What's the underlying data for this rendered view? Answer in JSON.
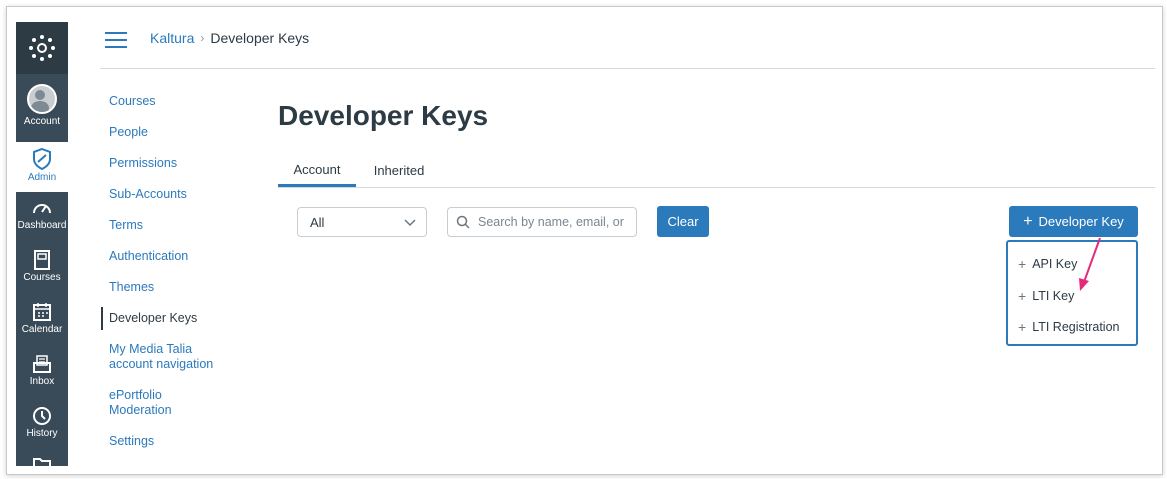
{
  "global_nav": {
    "items": [
      {
        "label": "Account",
        "icon": "user-avatar-icon"
      },
      {
        "label": "Admin",
        "icon": "shield-icon",
        "active": true
      },
      {
        "label": "Dashboard",
        "icon": "dashboard-icon"
      },
      {
        "label": "Courses",
        "icon": "book-icon"
      },
      {
        "label": "Calendar",
        "icon": "calendar-icon"
      },
      {
        "label": "Inbox",
        "icon": "inbox-icon"
      },
      {
        "label": "History",
        "icon": "clock-icon"
      }
    ]
  },
  "breadcrumb": {
    "root": "Kaltura",
    "separator": "›",
    "current": "Developer Keys"
  },
  "subnav": {
    "items": [
      {
        "label": "Courses"
      },
      {
        "label": "People"
      },
      {
        "label": "Permissions"
      },
      {
        "label": "Sub-Accounts"
      },
      {
        "label": "Terms"
      },
      {
        "label": "Authentication"
      },
      {
        "label": "Themes"
      },
      {
        "label": "Developer Keys",
        "active": true
      },
      {
        "label": "My Media Talia account navigation"
      },
      {
        "label": "ePortfolio Moderation"
      },
      {
        "label": "Settings"
      }
    ]
  },
  "page": {
    "title": "Developer Keys"
  },
  "tabs": [
    {
      "label": "Account",
      "active": true
    },
    {
      "label": "Inherited"
    }
  ],
  "filter": {
    "selected": "All",
    "search_placeholder": "Search by name, email, or"
  },
  "buttons": {
    "clear": "Clear",
    "add_developer_key": "Developer Key",
    "plus": "+"
  },
  "dropdown": {
    "items": [
      {
        "label": "API Key"
      },
      {
        "label": "LTI Key",
        "highlighted": true
      },
      {
        "label": "LTI Registration"
      }
    ]
  },
  "colors": {
    "accent": "#2b7abc",
    "nav_bg": "#394b58",
    "highlight": "#fbfb9a",
    "arrow": "#e8287a"
  }
}
